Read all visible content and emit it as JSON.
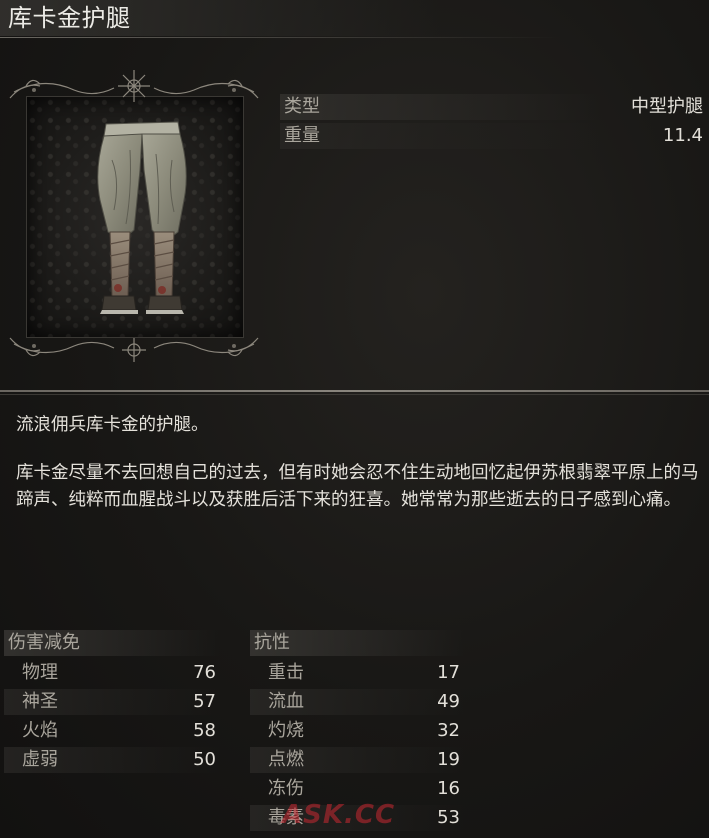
{
  "item": {
    "name": "库卡金护腿"
  },
  "attributes": [
    {
      "label": "类型",
      "value": "中型护腿"
    },
    {
      "label": "重量",
      "value": "11.4"
    }
  ],
  "description": {
    "line1": "流浪佣兵库卡金的护腿。",
    "line2": "库卡金尽量不去回想自己的过去，但有时她会忍不住生动地回忆起伊苏根翡翠平原上的马蹄声、纯粹而血腥战斗以及获胜后活下来的狂喜。她常常为那些逝去的日子感到心痛。"
  },
  "damage_negation": {
    "header": "伤害减免",
    "rows": [
      {
        "label": "物理",
        "value": "76"
      },
      {
        "label": "神圣",
        "value": "57"
      },
      {
        "label": "火焰",
        "value": "58"
      },
      {
        "label": "虚弱",
        "value": "50"
      }
    ]
  },
  "resistance": {
    "header": "抗性",
    "rows": [
      {
        "label": "重击",
        "value": "17"
      },
      {
        "label": "流血",
        "value": "49"
      },
      {
        "label": "灼烧",
        "value": "32"
      },
      {
        "label": "点燃",
        "value": "19"
      },
      {
        "label": "冻伤",
        "value": "16"
      },
      {
        "label": "毒素",
        "value": "53"
      }
    ]
  },
  "watermark": "ASK.CC",
  "icons": {
    "item_image": "leg-armor-icon",
    "frame_ornament": "ornate-frame-ornament"
  },
  "colors": {
    "background": "#151413",
    "text": "#e4e1da",
    "label": "#a9a59c"
  }
}
